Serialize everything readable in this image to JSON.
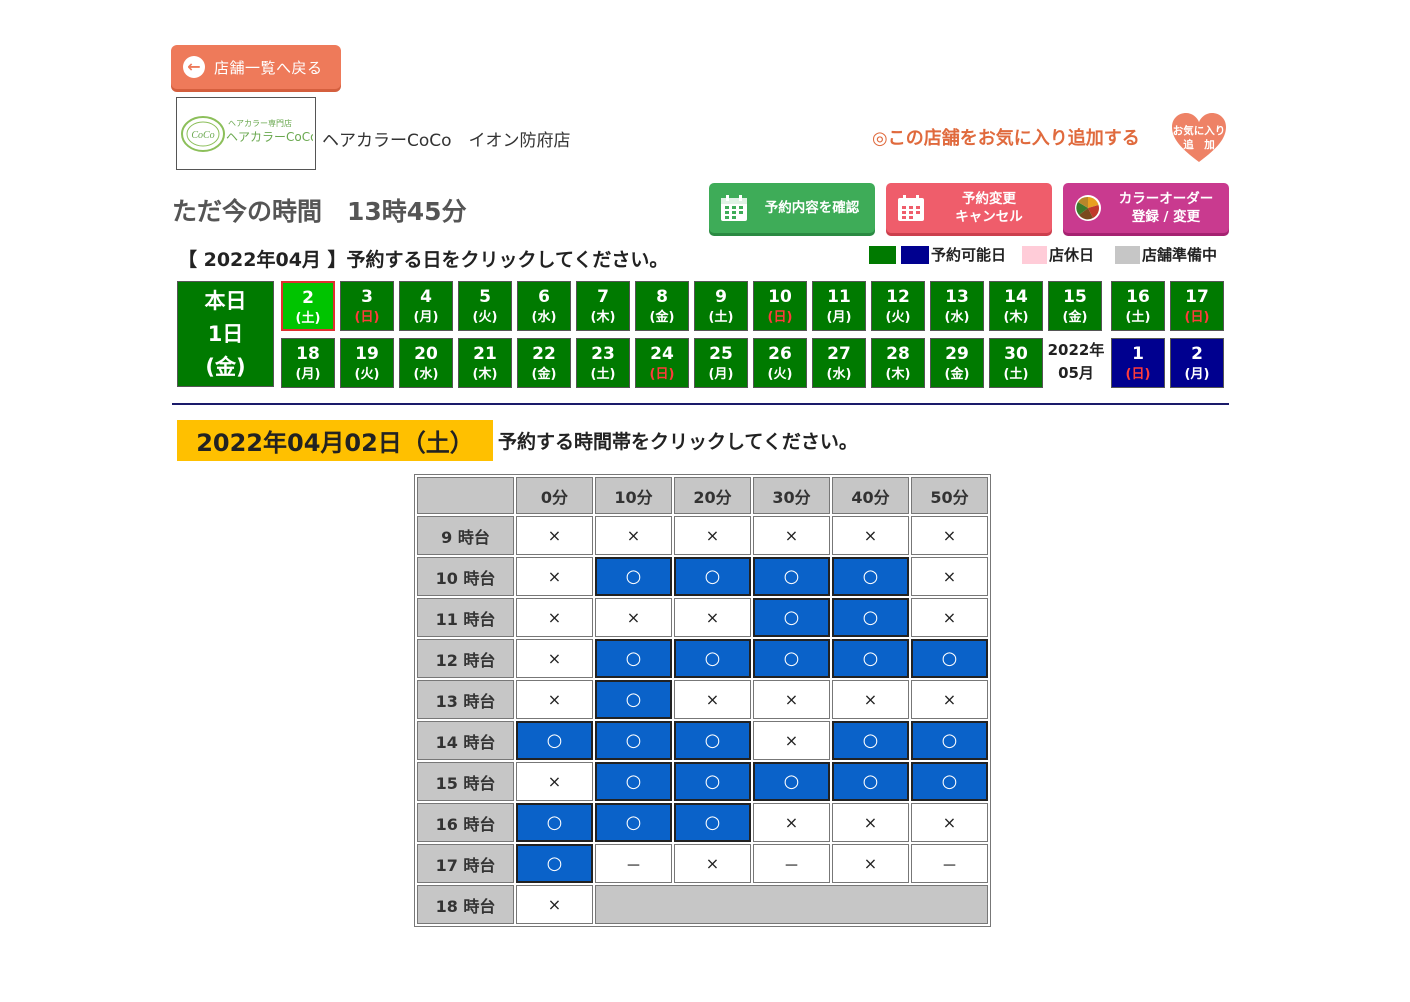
{
  "header": {
    "back_label": "店舗一覧へ戻る",
    "logo_text_top": "ヘアカラー専門店",
    "logo_text_main": "ヘアカラーCoCo",
    "logo_badge": "CoCo",
    "shop_name": "ヘアカラーCoCo　イオン防府店",
    "favorite_label": "◎この店舗をお気に入り追加する",
    "favorite_heart_line1": "お気に入り",
    "favorite_heart_line2": "追　加"
  },
  "current_time": "ただ今の時間　13時45分",
  "actions": {
    "confirm_label": "予約内容を確認",
    "change_line1": "予約変更",
    "change_line2": "キャンセル",
    "color_line1": "カラーオーダー",
    "color_line2": "登録 / 変更"
  },
  "month_instruction": "【 2022年04月 】予約する日をクリックしてください。",
  "legend": {
    "available": "予約可能日",
    "closed": "店休日",
    "preparing": "店舗準備中",
    "colors": {
      "green": "#007a00",
      "navy": "#00008f",
      "pink": "#ffccd8",
      "gray": "#c6c6c6"
    }
  },
  "calendar": {
    "today_line1": "本日",
    "today_line2": "1日",
    "today_line3": "(金)",
    "next_month_line1": "2022年",
    "next_month_line2": "05月",
    "row1": [
      {
        "n": "2",
        "w": "(土)",
        "selected": true
      },
      {
        "n": "3",
        "w": "(日)",
        "red": true
      },
      {
        "n": "4",
        "w": "(月)"
      },
      {
        "n": "5",
        "w": "(火)"
      },
      {
        "n": "6",
        "w": "(水)"
      },
      {
        "n": "7",
        "w": "(木)"
      },
      {
        "n": "8",
        "w": "(金)"
      },
      {
        "n": "9",
        "w": "(土)"
      },
      {
        "n": "10",
        "w": "(日)",
        "red": true
      },
      {
        "n": "11",
        "w": "(月)"
      },
      {
        "n": "12",
        "w": "(火)"
      },
      {
        "n": "13",
        "w": "(水)"
      },
      {
        "n": "14",
        "w": "(木)"
      },
      {
        "n": "15",
        "w": "(金)"
      },
      {
        "n": "16",
        "w": "(土)"
      },
      {
        "n": "17",
        "w": "(日)",
        "red": true
      }
    ],
    "row2": [
      {
        "n": "18",
        "w": "(月)"
      },
      {
        "n": "19",
        "w": "(火)"
      },
      {
        "n": "20",
        "w": "(水)"
      },
      {
        "n": "21",
        "w": "(木)"
      },
      {
        "n": "22",
        "w": "(金)"
      },
      {
        "n": "23",
        "w": "(土)"
      },
      {
        "n": "24",
        "w": "(日)",
        "red": true
      },
      {
        "n": "25",
        "w": "(月)"
      },
      {
        "n": "26",
        "w": "(火)"
      },
      {
        "n": "27",
        "w": "(水)"
      },
      {
        "n": "28",
        "w": "(木)"
      },
      {
        "n": "29",
        "w": "(金)"
      },
      {
        "n": "30",
        "w": "(土)"
      }
    ],
    "row2_next": [
      {
        "n": "1",
        "w": "(日)",
        "red": true
      },
      {
        "n": "2",
        "w": "(月)"
      }
    ]
  },
  "selected_date": "2022年04月02日（土）",
  "time_instruction": "予約する時間帯をクリックしてください。",
  "timetable": {
    "minutes": [
      "0分",
      "10分",
      "20分",
      "30分",
      "40分",
      "50分"
    ],
    "rows": [
      {
        "hour": "9 時台",
        "slots": [
          "×",
          "×",
          "×",
          "×",
          "×",
          "×"
        ]
      },
      {
        "hour": "10 時台",
        "slots": [
          "×",
          "○",
          "○",
          "○",
          "○",
          "×"
        ]
      },
      {
        "hour": "11 時台",
        "slots": [
          "×",
          "×",
          "×",
          "○",
          "○",
          "×"
        ]
      },
      {
        "hour": "12 時台",
        "slots": [
          "×",
          "○",
          "○",
          "○",
          "○",
          "○"
        ]
      },
      {
        "hour": "13 時台",
        "slots": [
          "×",
          "○",
          "×",
          "×",
          "×",
          "×"
        ]
      },
      {
        "hour": "14 時台",
        "slots": [
          "○",
          "○",
          "○",
          "×",
          "○",
          "○"
        ]
      },
      {
        "hour": "15 時台",
        "slots": [
          "×",
          "○",
          "○",
          "○",
          "○",
          "○"
        ]
      },
      {
        "hour": "16 時台",
        "slots": [
          "○",
          "○",
          "○",
          "×",
          "×",
          "×"
        ]
      },
      {
        "hour": "17 時台",
        "slots": [
          "○",
          "－",
          "×",
          "－",
          "×",
          "－"
        ]
      },
      {
        "hour": "18 時台",
        "slots": [
          "×"
        ]
      }
    ]
  }
}
